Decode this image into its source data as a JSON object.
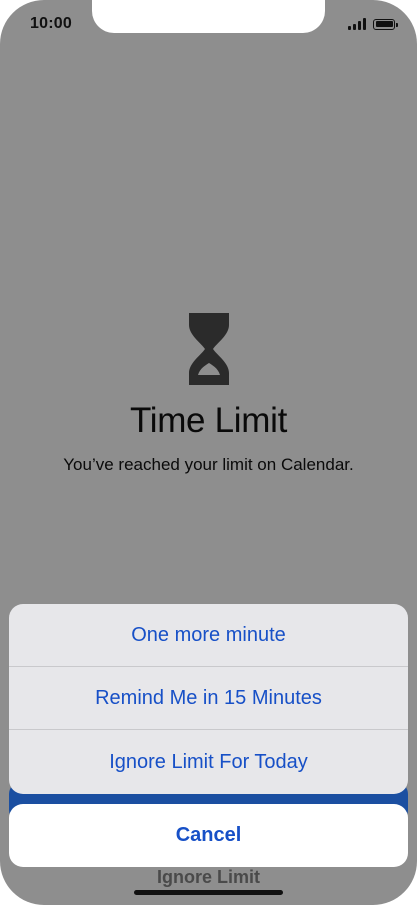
{
  "status_bar": {
    "time": "10:00",
    "signal_icon": "signal-icon",
    "battery_icon": "battery-icon"
  },
  "screen_time": {
    "icon": "hourglass-icon",
    "title": "Time Limit",
    "message": "You’ve reached your limit on Calendar.",
    "underlying_link": "Ignore Limit"
  },
  "action_sheet": {
    "options": [
      "One more minute",
      "Remind Me in 15 Minutes",
      "Ignore Limit For Today"
    ],
    "cancel_label": "Cancel"
  },
  "colors": {
    "dimmed_background": "#8e8e8e",
    "action_blue": "#1750c7",
    "sheet_background": "#e7e7ea",
    "underlying_button": "#1b4fa1"
  }
}
